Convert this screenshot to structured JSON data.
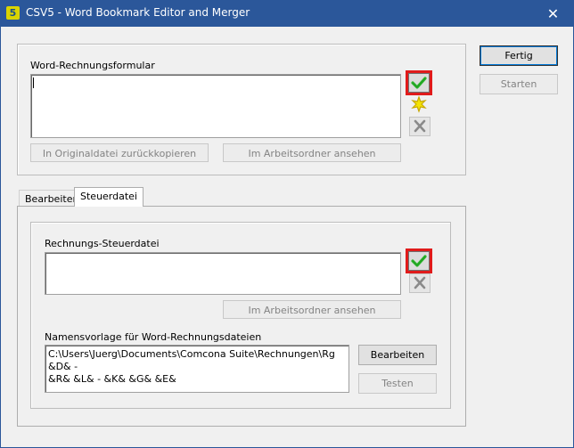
{
  "window": {
    "title": "CSV5 - Word Bookmark Editor and Merger",
    "app_icon": "5"
  },
  "top_group": {
    "label": "Word-Rechnungsformular",
    "value": "",
    "copy_back_label": "In Originaldatei zurückkopieren",
    "view_in_workfolder_label": "Im Arbeitsordner ansehen"
  },
  "right_buttons": {
    "done_label": "Fertig",
    "start_label": "Starten"
  },
  "tabs": [
    {
      "label": "Bearbeiten"
    },
    {
      "label": "Steuerdatei"
    }
  ],
  "steuer": {
    "label": "Rechnungs-Steuerdatei",
    "value": "",
    "view_in_workfolder_label": "Im Arbeitsordner ansehen",
    "name_template_label": "Namensvorlage für Word-Rechnungsdateien",
    "name_template_value": "C:\\Users\\Juerg\\Documents\\Comcona Suite\\Rechnungen\\Rg &D& -\n&R& &L& - &K& &G& &E&",
    "edit_label": "Bearbeiten",
    "test_label": "Testen"
  },
  "colors": {
    "check_green": "#2fb82f",
    "highlight_red": "#e01b1b",
    "titlebar": "#2b579a",
    "star_yellow": "#f5e400"
  },
  "icons": {
    "check": "check-icon",
    "star": "new-star-icon",
    "delete": "delete-x-icon",
    "close": "close-icon"
  }
}
